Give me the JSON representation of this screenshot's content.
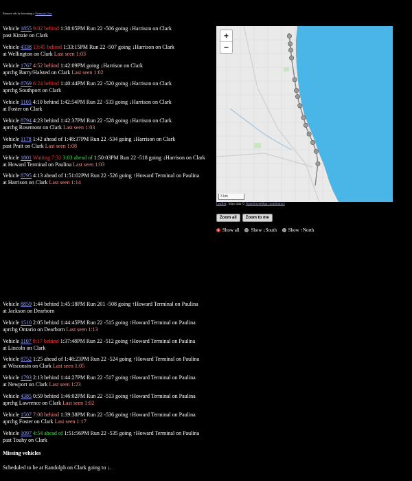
{
  "topnote": {
    "text": "Remove ads by becoming a",
    "link": "Premium User"
  },
  "vehicles_top": [
    {
      "label": "Vehicle",
      "id": "1855",
      "behind": "9:02 behind",
      "behind_color": "red",
      "time": "1:38:05PM",
      "run": "Run 22 -506",
      "dir": "going",
      "arrow": "↓",
      "dest": "Harrison on Clark",
      "line2": "past Kinzie on Clark",
      "seen": ""
    },
    {
      "label": "Vehicle",
      "id": "4338",
      "behind": "13:45 behind",
      "behind_color": "red",
      "time": "1:33:15PM",
      "run": "Run 22 -507",
      "dir": "going",
      "arrow": "↓",
      "dest": "Harrison on Clark",
      "line2": "at Wellington on Clark",
      "seen": "Last seen 1:03"
    },
    {
      "label": "Vehicle",
      "id": "1767",
      "behind": "4:52 behind",
      "behind_color": "pink",
      "time": "1:42:09PM",
      "run": "",
      "dir": "going",
      "arrow": "↓",
      "dest": "Harrison on Clark",
      "line2": "aprchg Barry/Halsted on Clark",
      "seen": "Last seen 1:02"
    },
    {
      "label": "Vehicle",
      "id": "8769",
      "behind": "6:24 behind",
      "behind_color": "red",
      "time": "1:40:44PM",
      "run": "Run 22 -520",
      "dir": "going",
      "arrow": "↓",
      "dest": "Harrison on Clark",
      "line2": "aprchg Southport on Clark",
      "seen": ""
    },
    {
      "label": "Vehicle",
      "id": "1105",
      "behind": "4:10 behind",
      "behind_color": "none",
      "time": "1:42:54PM",
      "run": "Run 22 -533",
      "dir": "going",
      "arrow": "↓",
      "dest": "Harrison on Clark",
      "line2": "at Foster on Clark",
      "seen": ""
    },
    {
      "label": "Vehicle",
      "id": "8794",
      "behind": "4:23 behind",
      "behind_color": "none",
      "time": "1:42:37PM",
      "run": "Run 22 -528",
      "dir": "going",
      "arrow": "↓",
      "dest": "Harrison on Clark",
      "line2": "aprchg Rosemont on Clark",
      "seen": "Last seen 1:03"
    },
    {
      "label": "Vehicle",
      "id": "1178",
      "behind": "1:42 ahead of",
      "behind_color": "none",
      "time": "1:48:37PM",
      "run": "Run 22 -534",
      "dir": "going",
      "arrow": "↓",
      "dest": "Harrison on Clark",
      "line2": "past Pratt on Clark",
      "seen": "Last seen 1:08"
    },
    {
      "label": "Vehicle",
      "id": "1801",
      "waiting": "Waiting 7:32",
      "behind": "3:03 ahead of",
      "behind_color": "green",
      "time": "1:50:03PM",
      "run": "Run 22 -518",
      "dir": "going",
      "arrow": "↓",
      "dest": "Harrison on Clark",
      "line2": "at Howard Terminal on Paulina",
      "seen": "Last seen 1:03"
    },
    {
      "label": "Vehicle",
      "id": "8795",
      "behind": "4:13 ahead of",
      "behind_color": "none",
      "time": "1:51:02PM",
      "run": "Run 22 -526",
      "dir": "going",
      "arrow": "↑",
      "dest": "Howard Terminal on Paulina",
      "line2": "at Harrison on Clark",
      "seen": "Last seen 1:14"
    }
  ],
  "vehicles_bottom": [
    {
      "label": "Vehicle",
      "id": "8859",
      "behind": "1:44 behind",
      "behind_color": "none",
      "time": "1:45:18PM",
      "run": "Run 201 -508",
      "dir": "going",
      "arrow": "↑",
      "dest": "Howard Terminal on Paulina",
      "line2": "at Jackson on Dearborn",
      "seen": ""
    },
    {
      "label": "Vehicle",
      "id": "1510",
      "behind": "2:05 behind",
      "behind_color": "none",
      "time": "1:44:45PM",
      "run": "Run 22 -515",
      "dir": "going",
      "arrow": "↑",
      "dest": "Howard Terminal on Paulina",
      "line2": "aprchg Ontario on Dearborn",
      "seen": "Last seen 1:13"
    },
    {
      "label": "Vehicle",
      "id": "1107",
      "behind": "9:17 behind",
      "behind_color": "red",
      "time": "1:37:48PM",
      "run": "Run 22 -512",
      "dir": "going",
      "arrow": "↑",
      "dest": "Howard Terminal on Paulina",
      "line2": "at Lincoln on Clark",
      "seen": ""
    },
    {
      "label": "Vehicle",
      "id": "8752",
      "behind": "1:25 ahead of",
      "behind_color": "none",
      "time": "1:48:23PM",
      "run": "Run 22 -524",
      "dir": "going",
      "arrow": "↑",
      "dest": "Howard Terminal on Paulina",
      "line2": "at Wisconsin on Clark",
      "seen": "Last seen 1:05"
    },
    {
      "label": "Vehicle",
      "id": "1793",
      "behind": "2:13 behind",
      "behind_color": "none",
      "time": "1:44:27PM",
      "run": "Run 22 -517",
      "dir": "going",
      "arrow": "↑",
      "dest": "Howard Terminal on Paulina",
      "line2": "at Newport on Clark",
      "seen": "Last seen 1:23"
    },
    {
      "label": "Vehicle",
      "id": "4385",
      "behind": "0:59 behind",
      "behind_color": "none",
      "time": "1:46:02PM",
      "run": "Run 22 -513",
      "dir": "going",
      "arrow": "↑",
      "dest": "Howard Terminal on Paulina",
      "line2": "aprchg Lawrence on Clark",
      "seen": "Last seen 1:02"
    },
    {
      "label": "Vehicle",
      "id": "1507",
      "behind": "7:08 behind",
      "behind_color": "pink",
      "time": "1:39:38PM",
      "run": "Run 22 -536",
      "dir": "going",
      "arrow": "↑",
      "dest": "Howard Terminal on Paulina",
      "line2": "aprchg Foster on Clark",
      "seen": "Last seen 1:17"
    },
    {
      "label": "Vehicle",
      "id": "1097",
      "behind": "4:54 ahead of",
      "behind_color": "green",
      "time": "1:51:56PM",
      "run": "Run 22 -535",
      "dir": "going",
      "arrow": "↑",
      "dest": "Howard Terminal on Paulina",
      "line2": "past Touhy on Clark",
      "seen": ""
    }
  ],
  "map": {
    "zoom_in": "+",
    "zoom_out": "−",
    "scale": "3 km",
    "attrib_link1": "Leaflet",
    "attrib_mid": " | Map data © ",
    "attrib_link2": "OpenStreetMap contributors",
    "lake_color": "#4ab6e8",
    "land_color": "#eaeaea",
    "route_color": "#888888"
  },
  "controls": {
    "zoom_all": "Zoom all",
    "zoom_me": "Zoom to me",
    "show_all": "Show all",
    "show_south_prefix": "Show ",
    "show_south_arrow": "↓",
    "show_south": "South",
    "show_north_prefix": "Show ",
    "show_north_arrow": "↑",
    "show_north": "North"
  },
  "missing": {
    "heading": "Missing vehicles",
    "sched_text": "Scheduled to be at Randolph on Clark going to",
    "sched_arrow": "↓",
    "sched_end": "."
  }
}
